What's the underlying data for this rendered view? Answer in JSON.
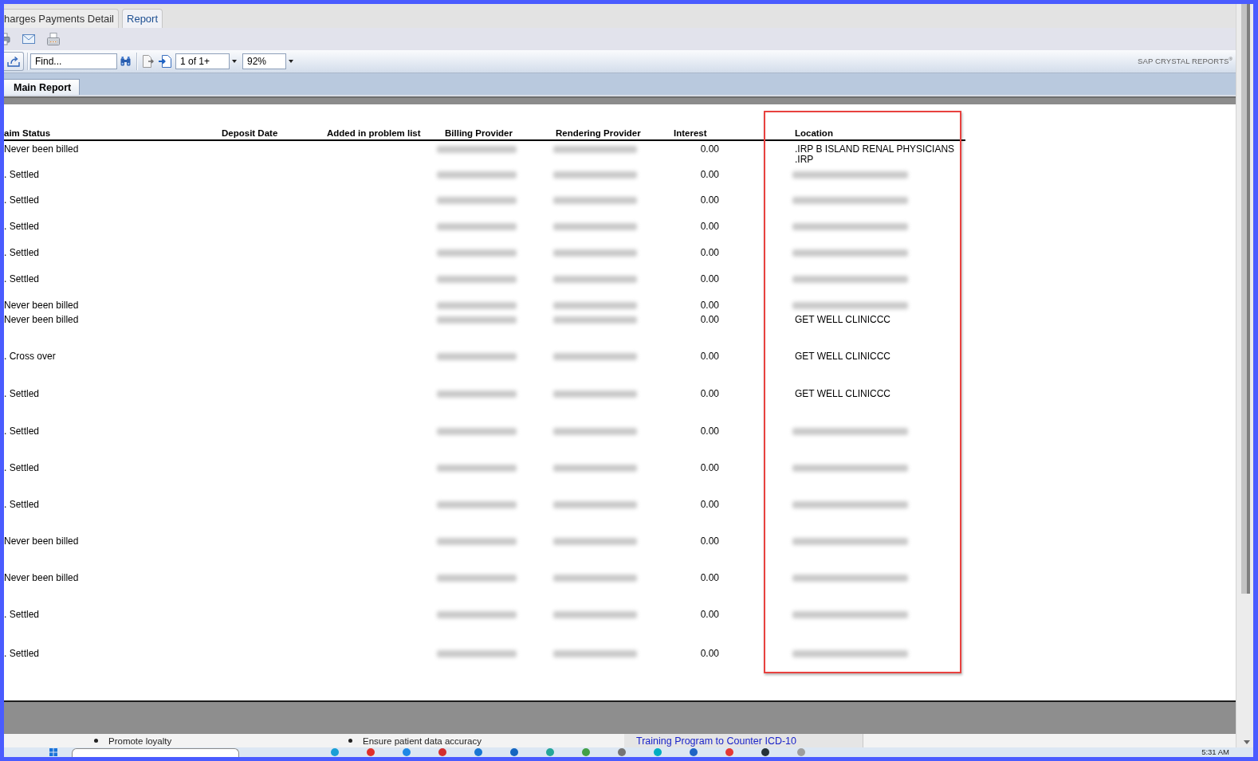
{
  "tabs": [
    {
      "label": "harges Payments Detail",
      "selected": false
    },
    {
      "label": "Report",
      "selected": true
    }
  ],
  "toolbar": {
    "find": {
      "placeholder": "Find..."
    },
    "page": {
      "value": "1 of 1+"
    },
    "zoom": {
      "value": "92%"
    },
    "brand": "SAP CRYSTAL REPORTS$^{®}$"
  },
  "report_tabs": [
    {
      "label": "Main Report",
      "selected": true
    }
  ],
  "table": {
    "columns": [
      {
        "label": "aim Status",
        "highlighted": false
      },
      {
        "label": "Deposit Date",
        "highlighted": false
      },
      {
        "label": "Added in problem list",
        "highlighted": false
      },
      {
        "label": "Billing Provider",
        "highlighted": false
      },
      {
        "label": "Rendering Provider",
        "highlighted": false
      },
      {
        "label": "Interest",
        "highlighted": false
      },
      {
        "label": "Location",
        "highlighted": true
      }
    ],
    "rows": [
      {
        "status": "Never been billed",
        "billing_provider": {
          "blurred": true
        },
        "rendering_provider": {
          "blurred": true
        },
        "interest": "0.00",
        "location": ".IRP B ISLAND RENAL PHYSICIANS .IRP"
      },
      {
        "status": ". Settled",
        "billing_provider": {
          "blurred": true
        },
        "rendering_provider": {
          "blurred": true
        },
        "interest": "0.00",
        "location": {
          "blurred": true
        }
      },
      {
        "status": ". Settled",
        "billing_provider": {
          "blurred": true
        },
        "rendering_provider": {
          "blurred": true
        },
        "interest": "0.00",
        "location": {
          "blurred": true
        }
      },
      {
        "status": ". Settled",
        "billing_provider": {
          "blurred": true
        },
        "rendering_provider": {
          "blurred": true
        },
        "interest": "0.00",
        "location": {
          "blurred": true
        }
      },
      {
        "status": ". Settled",
        "billing_provider": {
          "blurred": true
        },
        "rendering_provider": {
          "blurred": true
        },
        "interest": "0.00",
        "location": {
          "blurred": true
        }
      },
      {
        "status": ". Settled",
        "billing_provider": {
          "blurred": true
        },
        "rendering_provider": {
          "blurred": true
        },
        "interest": "0.00",
        "location": {
          "blurred": true
        }
      },
      {
        "status": "Never been billed",
        "billing_provider": {
          "blurred": true
        },
        "rendering_provider": {
          "blurred": true
        },
        "interest": "0.00",
        "location": {
          "blurred": true
        }
      },
      {
        "status": "Never been billed",
        "billing_provider": {
          "blurred": true
        },
        "rendering_provider": {
          "blurred": true
        },
        "interest": "0.00",
        "location": "GET WELL CLINICCC"
      },
      {
        "status": ". Cross over",
        "billing_provider": {
          "blurred": true
        },
        "rendering_provider": {
          "blurred": true
        },
        "interest": "0.00",
        "location": "GET WELL CLINICCC"
      },
      {
        "status": ". Settled",
        "billing_provider": {
          "blurred": true
        },
        "rendering_provider": {
          "blurred": true
        },
        "interest": "0.00",
        "location": "GET WELL CLINICCC"
      },
      {
        "status": ". Settled",
        "billing_provider": {
          "blurred": true
        },
        "rendering_provider": {
          "blurred": true
        },
        "interest": "0.00",
        "location": {
          "blurred": true
        }
      },
      {
        "status": ". Settled",
        "billing_provider": {
          "blurred": true
        },
        "rendering_provider": {
          "blurred": true
        },
        "interest": "0.00",
        "location": {
          "blurred": true
        }
      },
      {
        "status": ". Settled",
        "billing_provider": {
          "blurred": true
        },
        "rendering_provider": {
          "blurred": true
        },
        "interest": "0.00",
        "location": {
          "blurred": true
        }
      },
      {
        "status": "Never been billed",
        "billing_provider": {
          "blurred": true
        },
        "rendering_provider": {
          "blurred": true
        },
        "interest": "0.00",
        "location": {
          "blurred": true
        }
      },
      {
        "status": "Never been billed",
        "billing_provider": {
          "blurred": true
        },
        "rendering_provider": {
          "blurred": true
        },
        "interest": "0.00",
        "location": {
          "blurred": true
        }
      },
      {
        "status": ". Settled",
        "billing_provider": {
          "blurred": true
        },
        "rendering_provider": {
          "blurred": true
        },
        "interest": "0.00",
        "location": {
          "blurred": true
        }
      },
      {
        "status": ". Settled",
        "billing_provider": {
          "blurred": true
        },
        "rendering_provider": {
          "blurred": true
        },
        "interest": "0.00",
        "location": {
          "blurred": true
        }
      }
    ]
  },
  "background_page": {
    "bullets": [
      "Promote loyalty",
      "Ensure patient data accuracy"
    ],
    "link": "Training Program to Counter ICD-10"
  },
  "taskbar": {
    "time": "5:31 AM"
  }
}
